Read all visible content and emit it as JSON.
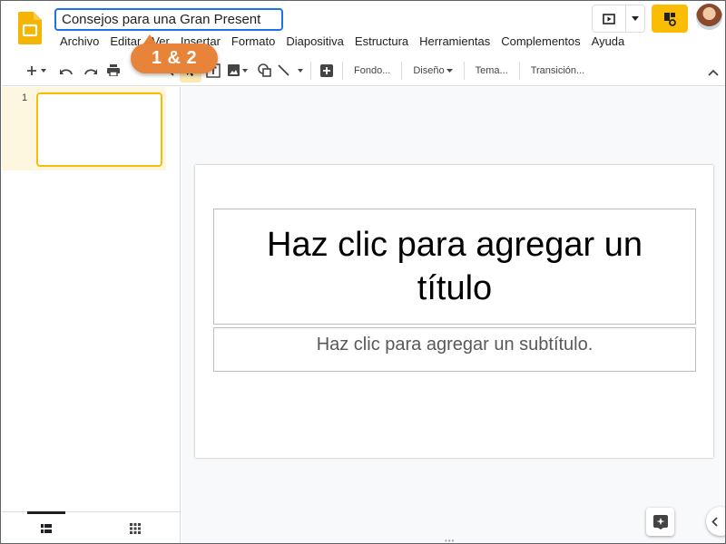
{
  "header": {
    "doc_title": "Consejos para una Gran Present",
    "menu": [
      "Archivo",
      "Editar",
      "Ver",
      "Insertar",
      "Formato",
      "Diapositiva",
      "Estructura",
      "Herramientas",
      "Complementos",
      "Ayuda"
    ]
  },
  "toolbar": {
    "background_label": "Fondo...",
    "layout_label": "Diseño",
    "theme_label": "Tema...",
    "transition_label": "Transición..."
  },
  "callout": {
    "label": "1 & 2",
    "color": "#e8833a"
  },
  "filmstrip": {
    "slides": [
      {
        "number": "1"
      }
    ]
  },
  "slide": {
    "title_placeholder": "Haz clic para agregar un título",
    "subtitle_placeholder": "Haz clic para agregar un subtítulo."
  },
  "colors": {
    "accent_blue": "#1a73e8",
    "share_yellow": "#fbbc04",
    "selected_slide_bg": "#fef7e0"
  },
  "icons": [
    "slides-logo-icon",
    "present-icon",
    "share-lock-icon",
    "add-icon",
    "undo-icon",
    "redo-icon",
    "print-icon",
    "zoom-icon",
    "select-cursor-icon",
    "text-box-icon",
    "image-icon",
    "shape-icon",
    "line-icon",
    "new-comment-icon",
    "chevron-up-icon",
    "explore-icon",
    "grid-view-icon",
    "list-view-icon",
    "chevron-left-icon"
  ]
}
